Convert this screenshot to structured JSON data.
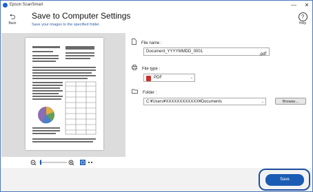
{
  "titlebar": {
    "app_name": "Epson ScanSmart",
    "minimize": "—",
    "close": "✕"
  },
  "header": {
    "back_label": "Back",
    "title": "Save to Computer Settings",
    "subtitle": "Save your images to the specified folder.",
    "help_label": "Help"
  },
  "form": {
    "file_name_label": "File name :",
    "file_name_value": "Document_YYYYMMDD_0001",
    "file_ext": ".pdf",
    "file_type_label": "File type :",
    "file_type_value": "PDF",
    "folder_label": "Folder :",
    "folder_value": "C:¥Users¥XXXXXXXXXXXX¥Documents",
    "browse_label": "Browse..."
  },
  "footer": {
    "save_label": "Save"
  },
  "colors": {
    "accent": "#1a5cb4",
    "pdf_icon": "#c9302c",
    "folder_icon": "#333333"
  }
}
